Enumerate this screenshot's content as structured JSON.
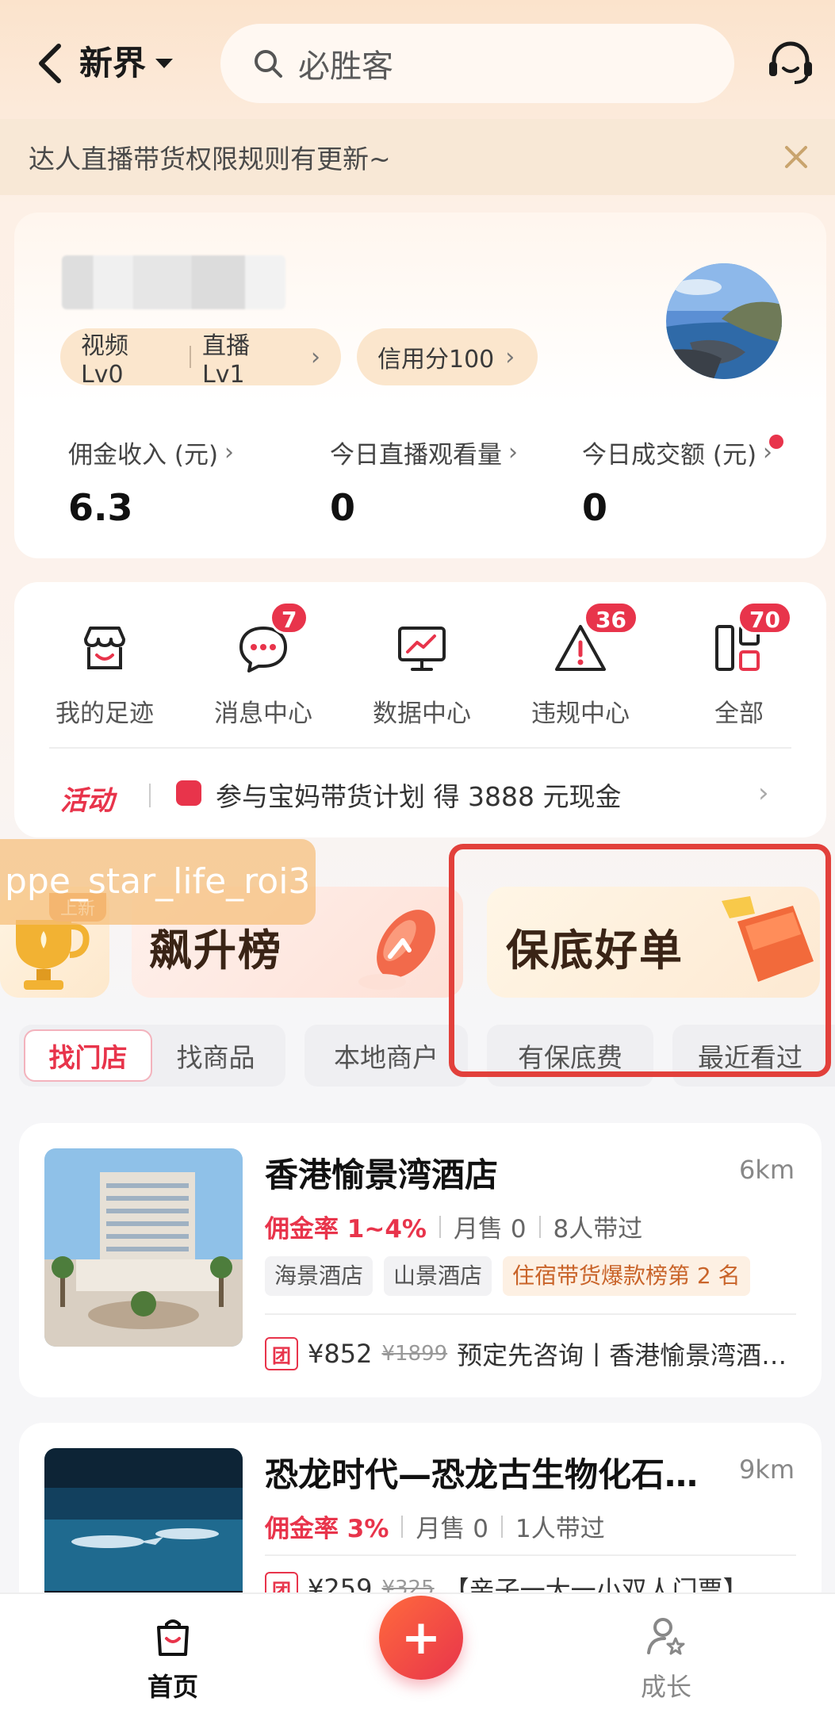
{
  "header": {
    "city": "新界",
    "search_placeholder": "必胜客"
  },
  "notice": {
    "text": "达人直播带货权限规则有更新~"
  },
  "profile": {
    "levels": {
      "video": "视频 Lv0",
      "live": "直播 Lv1"
    },
    "credit": "信用分100",
    "stats": [
      {
        "label": "佣金收入 (元)",
        "value": "6.3"
      },
      {
        "label": "今日直播观看量",
        "value": "0"
      },
      {
        "label": "今日成交额 (元)",
        "value": "0"
      }
    ]
  },
  "tools": {
    "items": [
      {
        "label": "我的足迹",
        "badge": ""
      },
      {
        "label": "消息中心",
        "badge": "7"
      },
      {
        "label": "数据中心",
        "badge": ""
      },
      {
        "label": "违规中心",
        "badge": "36"
      },
      {
        "label": "全部",
        "badge": "70"
      }
    ],
    "activity_tag": "活动",
    "activity_text": "参与宝妈带货计划  得 3888 元现金"
  },
  "banners": {
    "new_tag": "上新",
    "rise": "飙升榜",
    "guarantee": "保底好单",
    "overlay_label": "ppe_star_life_roi3"
  },
  "filters": {
    "seg_active": "找门店",
    "seg_inactive": "找商品",
    "chips": [
      "本地商户",
      "有保底费",
      "最近看过"
    ]
  },
  "listings": [
    {
      "title": "香港愉景湾酒店",
      "distance": "6km",
      "rate": "佣金率 1~4%",
      "sales": "月售 0",
      "promoters": "8人带过",
      "tags": [
        "海景酒店",
        "山景酒店"
      ],
      "rank_tag": "住宿带货爆款榜第 2 名",
      "deal_mark": "团",
      "price": "¥852",
      "original_price": "¥1899",
      "deal_text": "预定先咨询丨香港愉景湾酒…"
    },
    {
      "title": "恐龙时代—恐龙古生物化石…",
      "distance": "9km",
      "rate": "佣金率 3%",
      "sales": "月售 0",
      "promoters": "1人带过",
      "deal_mark": "团",
      "price": "¥259",
      "original_price": "¥325",
      "deal_text": "【亲子一大一小双人门票】"
    }
  ],
  "bottom_nav": {
    "home": "首页",
    "growth": "成长",
    "add_symbol": "+"
  },
  "colors": {
    "accent": "#e8344b",
    "highlight_border": "#e2403b"
  }
}
